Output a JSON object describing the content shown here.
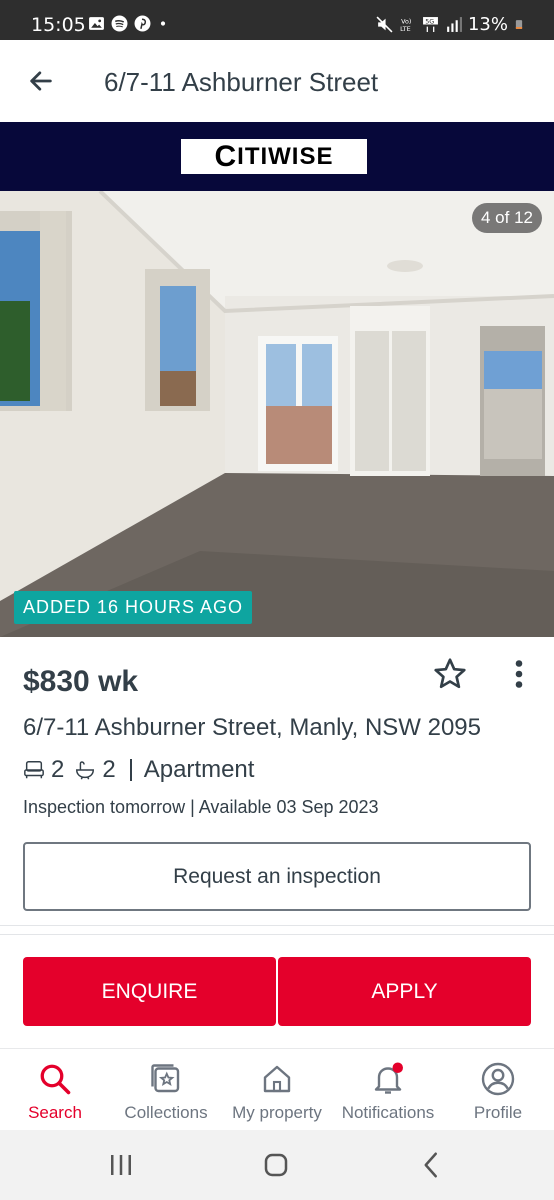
{
  "status_bar": {
    "time": "15:05",
    "battery": "13%",
    "icons": [
      "gallery-icon",
      "spotify-icon",
      "pinterest-icon",
      "dot-icon",
      "mute-icon",
      "volte-icon",
      "5g-icon",
      "signal-icon",
      "battery-icon"
    ]
  },
  "header": {
    "title": "6/7-11 Ashburner Street",
    "back_icon": "back-arrow-icon"
  },
  "agency": {
    "logo_first": "C",
    "logo_rest": "ITIWISE",
    "banner_color": "#07083a"
  },
  "gallery": {
    "counter": "4 of 12",
    "badge": "ADDED 16 HOURS AGO"
  },
  "listing": {
    "price": "$830 wk",
    "address": "6/7-11 Ashburner Street, Manly, NSW 2095",
    "bedrooms": "2",
    "bathrooms": "2",
    "property_type": "Apartment",
    "inspection": "Inspection tomorrow | Available 03 Sep 2023"
  },
  "actions": {
    "request_inspection": "Request an inspection",
    "enquire": "ENQUIRE",
    "apply": "APPLY"
  },
  "bottom_nav": {
    "items": [
      {
        "label": "Search",
        "icon": "search-icon",
        "active": true
      },
      {
        "label": "Collections",
        "icon": "collections-icon",
        "active": false
      },
      {
        "label": "My property",
        "icon": "home-icon",
        "active": false
      },
      {
        "label": "Notifications",
        "icon": "bell-icon",
        "active": false
      },
      {
        "label": "Profile",
        "icon": "profile-icon",
        "active": false
      }
    ]
  },
  "colors": {
    "brand_red": "#e4002b",
    "badge_teal": "#0ea5a0",
    "text_dark": "#333f48"
  }
}
